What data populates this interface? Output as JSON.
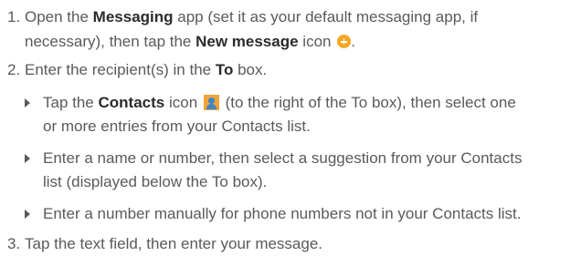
{
  "steps": {
    "s1": {
      "num": "1.",
      "line1_a": "Open the ",
      "line1_b": "Messaging",
      "line1_c": " app (set it as your default messaging app, if",
      "line2_a": "necessary), then tap the ",
      "line2_b": "New message",
      "line2_c": " icon",
      "line2_d": ".",
      "icon": "new-message-icon"
    },
    "s2": {
      "num": "2.",
      "text_a": "Enter the recipient(s) in the ",
      "text_b": "To",
      "text_c": " box."
    },
    "s3": {
      "num": "3.",
      "text": "Tap the text field, then enter your message."
    }
  },
  "bullets": {
    "b1": {
      "line1_a": "Tap the ",
      "line1_b": "Contacts",
      "line1_c": " icon",
      "line1_d": " (to the right of the To box), then select one",
      "line2": "or more entries from your Contacts list.",
      "icon": "contacts-icon"
    },
    "b2": {
      "line1": "Enter a name or number, then select a suggestion from your Contacts",
      "line2": "list (displayed below the To box)."
    },
    "b3": {
      "line1": "Enter a number manually for phone numbers not in your Contacts list."
    }
  },
  "colors": {
    "text": "#5a5a5a",
    "bold": "#2b2b2b",
    "accent_orange": "#f5a623",
    "contacts_blue": "#3a86c8"
  }
}
